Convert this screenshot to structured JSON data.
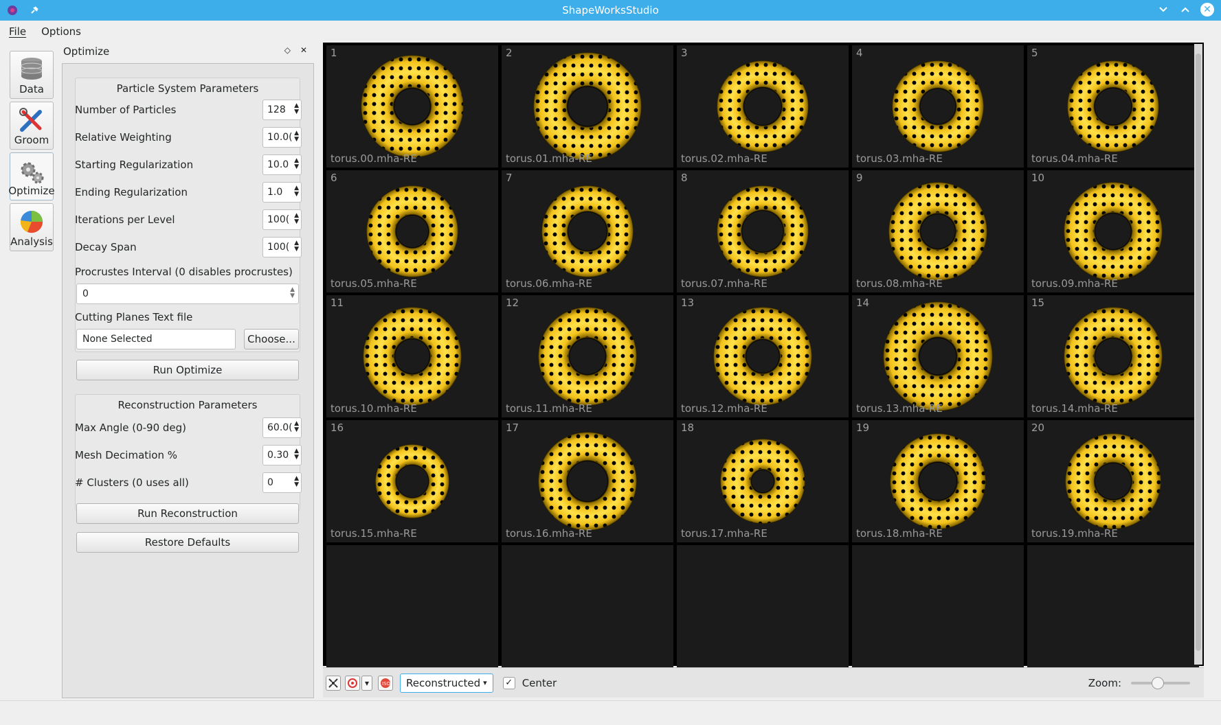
{
  "window": {
    "title": "ShapeWorksStudio"
  },
  "menu": {
    "file": "File",
    "options": "Options"
  },
  "tools": [
    {
      "label": "Data"
    },
    {
      "label": "Groom"
    },
    {
      "label": "Optimize"
    },
    {
      "label": "Analysis"
    }
  ],
  "dock": {
    "title": "Optimize"
  },
  "particle": {
    "title": "Particle System Parameters",
    "rows": [
      {
        "label": "Number of Particles",
        "value": "128"
      },
      {
        "label": "Relative Weighting",
        "value": "10.0("
      },
      {
        "label": "Starting Regularization",
        "value": "10.0"
      },
      {
        "label": "Ending Regularization",
        "value": "1.0"
      },
      {
        "label": "Iterations per Level",
        "value": "100("
      },
      {
        "label": "Decay Span",
        "value": "100("
      }
    ],
    "procrustes_label": "Procrustes Interval (0 disables procrustes)",
    "procrustes_value": "0",
    "cutting_label": "Cutting Planes Text file",
    "cutting_value": "None Selected",
    "choose_label": "Choose...",
    "run_label": "Run Optimize"
  },
  "reconstruction": {
    "title": "Reconstruction Parameters",
    "rows": [
      {
        "label": "Max Angle (0-90 deg)",
        "value": "60.0("
      },
      {
        "label": "Mesh Decimation %",
        "value": "0.30"
      },
      {
        "label": "# Clusters (0 uses all)",
        "value": "0"
      }
    ],
    "run_label": "Run Reconstruction",
    "restore_label": "Restore Defaults"
  },
  "viewer": {
    "tiles": [
      {
        "num": "1",
        "name": "torus.00.mha-RE"
      },
      {
        "num": "2",
        "name": "torus.01.mha-RE"
      },
      {
        "num": "3",
        "name": "torus.02.mha-RE"
      },
      {
        "num": "4",
        "name": "torus.03.mha-RE"
      },
      {
        "num": "5",
        "name": "torus.04.mha-RE"
      },
      {
        "num": "6",
        "name": "torus.05.mha-RE"
      },
      {
        "num": "7",
        "name": "torus.06.mha-RE"
      },
      {
        "num": "8",
        "name": "torus.07.mha-RE"
      },
      {
        "num": "9",
        "name": "torus.08.mha-RE"
      },
      {
        "num": "10",
        "name": "torus.09.mha-RE"
      },
      {
        "num": "11",
        "name": "torus.10.mha-RE"
      },
      {
        "num": "12",
        "name": "torus.11.mha-RE"
      },
      {
        "num": "13",
        "name": "torus.12.mha-RE"
      },
      {
        "num": "14",
        "name": "torus.13.mha-RE"
      },
      {
        "num": "15",
        "name": "torus.14.mha-RE"
      },
      {
        "num": "16",
        "name": "torus.15.mha-RE"
      },
      {
        "num": "17",
        "name": "torus.16.mha-RE"
      },
      {
        "num": "18",
        "name": "torus.17.mha-RE"
      },
      {
        "num": "19",
        "name": "torus.18.mha-RE"
      },
      {
        "num": "20",
        "name": "torus.19.mha-RE"
      }
    ],
    "empty_tiles": 5
  },
  "viewbar": {
    "mode": "Reconstructed",
    "center_label": "Center",
    "zoom_label": "Zoom:",
    "zoom_level": 0.45
  },
  "colors": {
    "torus": "#f2c21b",
    "accent": "#3daee9"
  }
}
